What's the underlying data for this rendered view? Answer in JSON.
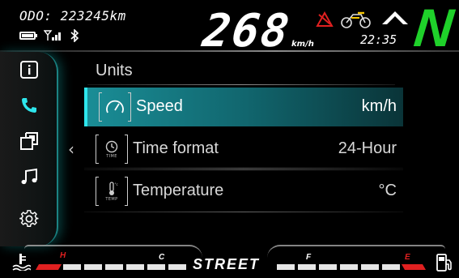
{
  "status": {
    "odometer": "ODO: 223245km",
    "speed": "268",
    "speed_unit": "km/h",
    "clock": "22:35",
    "gear": "N"
  },
  "colors": {
    "accent": "#2ee6ec",
    "gear": "#1fd12a",
    "warning": "#e02020"
  },
  "nav": {
    "items": [
      {
        "icon": "info-icon"
      },
      {
        "icon": "phone-icon"
      },
      {
        "icon": "screens-icon"
      },
      {
        "icon": "music-icon"
      },
      {
        "icon": "settings-gear-icon"
      }
    ],
    "selected_index": 1
  },
  "menu": {
    "title": "Units",
    "back_icon": "chevron-left-icon",
    "rows": [
      {
        "label": "Speed",
        "value": "km/h",
        "icon": "speedometer-icon",
        "icon_caption": "",
        "selected": true
      },
      {
        "label": "Time format",
        "value": "24-Hour",
        "icon": "clock-icon",
        "icon_caption": "TIME",
        "selected": false
      },
      {
        "label": "Temperature",
        "value": "°C",
        "icon": "thermometer-icon",
        "icon_caption": "TEMP",
        "selected": false
      }
    ]
  },
  "bottom": {
    "riding_mode": "STREET",
    "temp_gauge": {
      "hot_label": "H",
      "cold_label": "C",
      "icon": "coolant-temp-icon"
    },
    "fuel_gauge": {
      "full_label": "F",
      "empty_label": "E",
      "icon": "fuel-pump-icon"
    }
  }
}
